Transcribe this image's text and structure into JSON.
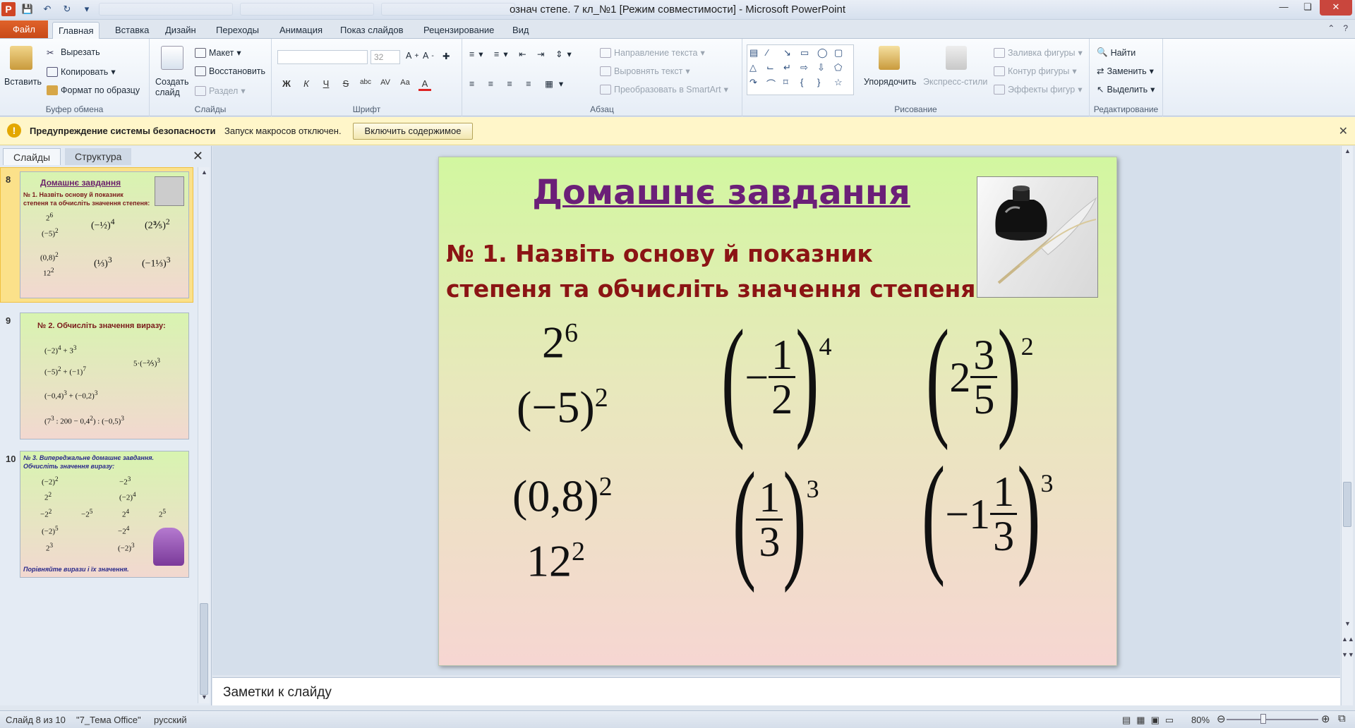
{
  "window": {
    "title": "означ степе. 7 кл_№1 [Режим совместимости]  -  Microsoft PowerPoint",
    "app_icon": "P"
  },
  "ribbon_tabs": {
    "file": "Файл",
    "items": [
      "Главная",
      "Вставка",
      "Дизайн",
      "Переходы",
      "Анимация",
      "Показ слайдов",
      "Рецензирование",
      "Вид"
    ],
    "active": "Главная"
  },
  "clipboard": {
    "paste": "Вставить",
    "cut": "Вырезать",
    "copy": "Копировать",
    "format_painter": "Формат по образцу",
    "label": "Буфер обмена"
  },
  "slides_group": {
    "new_slide": "Создать слайд",
    "layout": "Макет",
    "reset": "Восстановить",
    "section": "Раздел",
    "label": "Слайды"
  },
  "font_group": {
    "font_size": "32",
    "label": "Шрифт",
    "buttons": [
      "Ж",
      "К",
      "Ч",
      "S",
      "abc",
      "AV",
      "Aa",
      "A"
    ]
  },
  "paragraph_group": {
    "text_direction": "Направление текста",
    "align_text": "Выровнять текст",
    "convert_smartart": "Преобразовать в SmartArt",
    "label": "Абзац"
  },
  "drawing_group": {
    "arrange": "Упорядочить",
    "quick_styles": "Экспресс-стили",
    "shape_fill": "Заливка фигуры",
    "shape_outline": "Контур фигуры",
    "shape_effects": "Эффекты фигур",
    "label": "Рисование"
  },
  "editing_group": {
    "find": "Найти",
    "replace": "Заменить",
    "select": "Выделить",
    "label": "Редактирование"
  },
  "security_bar": {
    "title": "Предупреждение системы безопасности",
    "message": "Запуск макросов отключен.",
    "button": "Включить содержимое"
  },
  "left_pane": {
    "tab_slides": "Слайды",
    "tab_outline": "Структура",
    "thumbnails": [
      {
        "number": "8",
        "title": "Домашнє завдання",
        "subtitle_line1": "№ 1. Назвіть основу й показник",
        "subtitle_line2": "степеня та обчисліть значення степеня:"
      },
      {
        "number": "9",
        "title": "№ 2. Обчисліть значення виразу:"
      },
      {
        "number": "10",
        "title_line1": "№ 3. Випереджальне домашнє завдання.",
        "title_line2": "Обчисліть значення виразу:",
        "footer": "Порівняйте вирази і їх значення."
      }
    ]
  },
  "slide": {
    "title": "Домашнє завдання",
    "task_line1": "№ 1. Назвіть основу й показник",
    "task_line2": "степеня та обчисліть значення степеня:",
    "expressions": {
      "e1_base": "2",
      "e1_exp": "6",
      "e2_base": "(−5)",
      "e2_exp": "2",
      "e3_num": "1",
      "e3_den": "2",
      "e3_exp": "4",
      "e4_whole": "2",
      "e4_num": "3",
      "e4_den": "5",
      "e4_exp": "2",
      "e5_base": "(0,8)",
      "e5_exp": "2",
      "e6_base": "12",
      "e6_exp": "2",
      "e7_num": "1",
      "e7_den": "3",
      "e7_exp": "3",
      "e8_whole": "−1",
      "e8_num": "1",
      "e8_den": "3",
      "e8_exp": "3"
    }
  },
  "notes": {
    "placeholder": "Заметки к слайду"
  },
  "status_bar": {
    "slide_info": "Слайд 8 из 10",
    "theme": "\"7_Тема Office\"",
    "language": "русский",
    "zoom": "80%"
  }
}
